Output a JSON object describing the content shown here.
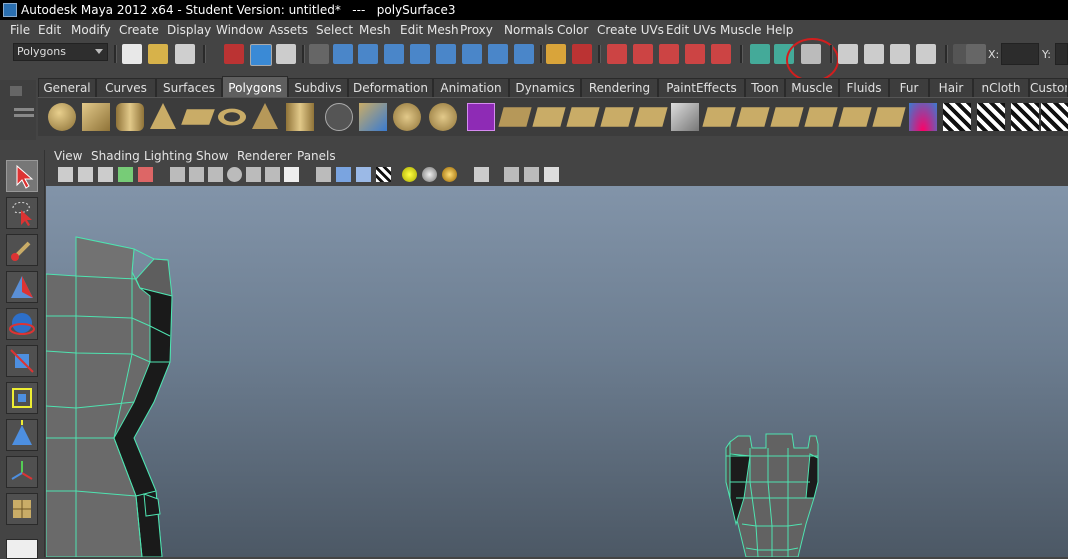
{
  "window": {
    "title": "Autodesk Maya 2012 x64 - Student Version: untitled*   ---   polySurface3"
  },
  "menubar": {
    "items": [
      "File",
      "Edit",
      "Modify",
      "Create",
      "Display",
      "Window",
      "Assets",
      "Select",
      "Mesh",
      "Edit Mesh",
      "Proxy",
      "Normals",
      "Color",
      "Create UVs",
      "Edit UVs",
      "Muscle",
      "Help"
    ]
  },
  "status_line": {
    "mode_menu": "Polygons",
    "x_label": "X:",
    "y_label": "Y:"
  },
  "shelf": {
    "tabs": [
      "General",
      "Curves",
      "Surfaces",
      "Polygons",
      "Subdivs",
      "Deformation",
      "Animation",
      "Dynamics",
      "Rendering",
      "PaintEffects",
      "Toon",
      "Muscle",
      "Fluids",
      "Fur",
      "Hair",
      "nCloth",
      "Custom"
    ],
    "active_tab": "Polygons"
  },
  "panel_menu": {
    "items": [
      "View",
      "Shading",
      "Lighting",
      "Show",
      "Renderer",
      "Panels"
    ]
  },
  "colors": {
    "wireframe_highlight": "#4fe3b0",
    "annotation_circle": "#d21e1e",
    "viewport_top": "#8294a9",
    "viewport_bottom": "#4c5865"
  }
}
